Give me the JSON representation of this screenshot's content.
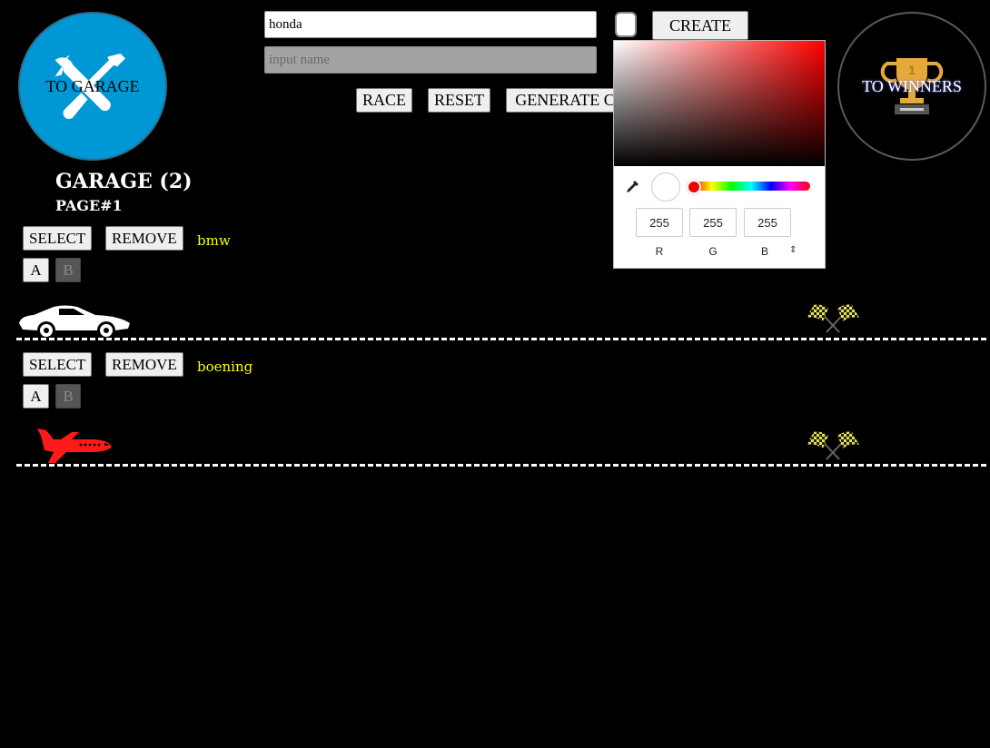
{
  "nav": {
    "garage_label": "TO GARAGE",
    "winners_label": "TO WINNERS"
  },
  "create": {
    "name_value": "honda",
    "button_label": "CREATE",
    "color": "#ffffff"
  },
  "update": {
    "placeholder": "input name"
  },
  "controls": {
    "race_label": "RACE",
    "reset_label": "RESET",
    "generate_label": "GENERATE C"
  },
  "color_picker": {
    "r": "255",
    "g": "255",
    "b": "255",
    "r_label": "R",
    "g_label": "G",
    "b_label": "B",
    "toggle_icon": "up-down-chevron-icon"
  },
  "garage": {
    "title": "GARAGE (2)",
    "page": "PAGE#1"
  },
  "cars": [
    {
      "name": "bmw",
      "select_label": "SELECT",
      "remove_label": "REMOVE",
      "start_label": "A",
      "stop_label": "B",
      "icon": "car-icon",
      "color": "#ffffff"
    },
    {
      "name": "boening",
      "select_label": "SELECT",
      "remove_label": "REMOVE",
      "start_label": "A",
      "stop_label": "B",
      "icon": "plane-icon",
      "color": "#ff1a1a"
    }
  ],
  "colors": {
    "accent": "#0097d6",
    "car_name": "#ffff00",
    "background": "#000000"
  }
}
